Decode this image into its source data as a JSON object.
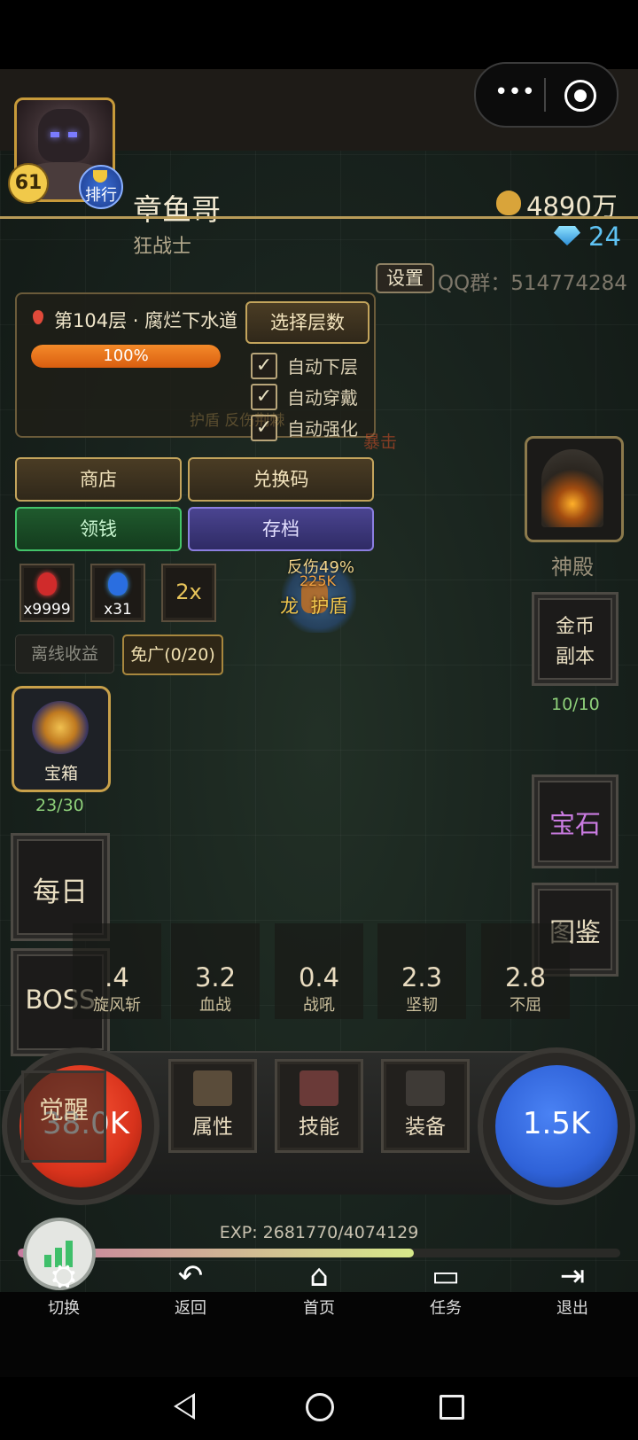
{
  "header": {
    "player_name": "章鱼哥",
    "player_class": "狂战士",
    "level": "61",
    "rank_label": "排行",
    "gold": "4890万",
    "diamonds": "24",
    "settings_label": "设置",
    "qq_group": "QQ群：514774284"
  },
  "floor_panel": {
    "floor_text": "第104层 · 腐烂下水道",
    "progress": "100%",
    "progress_value": 1.0,
    "select_floor_label": "选择层数",
    "options": [
      {
        "label": "自动下层",
        "checked": true
      },
      {
        "label": "自动穿戴",
        "checked": true
      },
      {
        "label": "自动强化",
        "checked": true
      }
    ]
  },
  "actions": {
    "shop": "商店",
    "redeem": "兑换码",
    "collect": "领钱",
    "save": "存档"
  },
  "items": [
    {
      "icon": "red-potion-icon",
      "count": "x9999"
    },
    {
      "icon": "blue-potion-icon",
      "count": "x31"
    },
    {
      "icon": "speed-2x-icon",
      "count": "2x"
    }
  ],
  "offline": {
    "income_label": "离线收益",
    "ad_free_label": "免广(0/20)"
  },
  "chest": {
    "label": "宝箱",
    "count": "23/30"
  },
  "left_menu": {
    "daily": "每日",
    "boss": "BOSS",
    "awaken": "觉醒"
  },
  "right_menu": {
    "temple": "神殿",
    "gold_dungeon_line1": "金币",
    "gold_dungeon_line2": "副本",
    "gold_dungeon_count": "10/10",
    "gem": "宝石",
    "codex": "图鉴"
  },
  "combat_text": {
    "reflect": "反伤49%",
    "damage": "225K",
    "buff": "龙  护盾",
    "faded1": "护盾   反伤荆棘",
    "faded2": "暴击"
  },
  "skills": [
    {
      "value": ".4",
      "name": "旋风斩"
    },
    {
      "value": "3.2",
      "name": "血战"
    },
    {
      "value": "0.4",
      "name": "战吼"
    },
    {
      "value": "2.3",
      "name": "坚韧"
    },
    {
      "value": "2.8",
      "name": "不屈"
    }
  ],
  "orbs": {
    "hp_partial": "38.0K",
    "mp": "1.5K"
  },
  "bottom_menu": {
    "attributes": "属性",
    "skills": "技能",
    "equipment": "装备"
  },
  "exp": {
    "text": "EXP: 2681770/4074129",
    "fraction": 0.658
  },
  "nav": {
    "switch": "切换",
    "back": "返回",
    "home": "首页",
    "tasks": "任务",
    "exit": "退出"
  },
  "colors": {
    "accent_gold": "#c3a45c",
    "exp_bar": "#d7e98a",
    "mp_orb": "#2f62d8",
    "hp_orb": "#e23a1f"
  }
}
